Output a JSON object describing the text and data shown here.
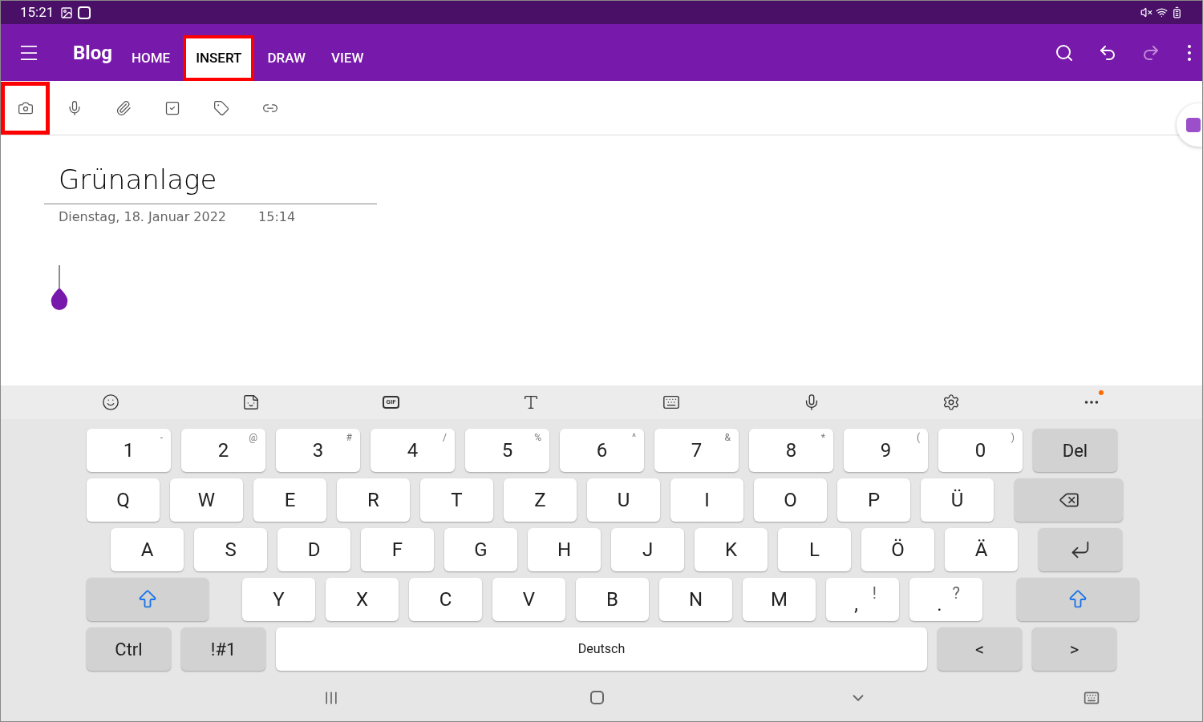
{
  "status_bar": {
    "time": "15:21"
  },
  "app_bar": {
    "notebook": "Blog",
    "tabs": [
      {
        "label": "HOME",
        "selected": false,
        "highlighted": false
      },
      {
        "label": "INSERT",
        "selected": true,
        "highlighted": true
      },
      {
        "label": "DRAW",
        "selected": false,
        "highlighted": false
      },
      {
        "label": "VIEW",
        "selected": false,
        "highlighted": false
      }
    ],
    "redo_disabled": true
  },
  "ribbon": {
    "tools": [
      {
        "kind": "camera",
        "highlighted": true
      },
      {
        "kind": "microphone",
        "highlighted": false
      },
      {
        "kind": "attachment",
        "highlighted": false
      },
      {
        "kind": "checkbox",
        "highlighted": false
      },
      {
        "kind": "tag",
        "highlighted": false
      },
      {
        "kind": "link",
        "highlighted": false
      }
    ]
  },
  "page": {
    "title": "Grünanlage",
    "date": "Dienstag, 18. Januar 2022",
    "time": "15:14"
  },
  "keyboard": {
    "more_notification": true,
    "gif_label": "GIF",
    "rows": [
      {
        "keys": [
          {
            "kind": "char",
            "label": "1",
            "hint": "-"
          },
          {
            "kind": "char",
            "label": "2",
            "hint": "@"
          },
          {
            "kind": "char",
            "label": "3",
            "hint": "#"
          },
          {
            "kind": "char",
            "label": "4",
            "hint": "/"
          },
          {
            "kind": "char",
            "label": "5",
            "hint": "%"
          },
          {
            "kind": "char",
            "label": "6",
            "hint": "^"
          },
          {
            "kind": "char",
            "label": "7",
            "hint": "&"
          },
          {
            "kind": "char",
            "label": "8",
            "hint": "*"
          },
          {
            "kind": "char",
            "label": "9",
            "hint": "("
          },
          {
            "kind": "char",
            "label": "0",
            "hint": ")"
          },
          {
            "kind": "fn",
            "label": "Del"
          }
        ]
      },
      {
        "keys": [
          {
            "kind": "char",
            "label": "Q"
          },
          {
            "kind": "char",
            "label": "W"
          },
          {
            "kind": "char",
            "label": "E"
          },
          {
            "kind": "char",
            "label": "R"
          },
          {
            "kind": "char",
            "label": "T"
          },
          {
            "kind": "char",
            "label": "Z"
          },
          {
            "kind": "char",
            "label": "U"
          },
          {
            "kind": "char",
            "label": "I"
          },
          {
            "kind": "char",
            "label": "O"
          },
          {
            "kind": "char",
            "label": "P"
          },
          {
            "kind": "char",
            "label": "Ü"
          },
          {
            "kind": "backspace"
          }
        ]
      },
      {
        "keys": [
          {
            "kind": "char",
            "label": "A"
          },
          {
            "kind": "char",
            "label": "S"
          },
          {
            "kind": "char",
            "label": "D"
          },
          {
            "kind": "char",
            "label": "F"
          },
          {
            "kind": "char",
            "label": "G"
          },
          {
            "kind": "char",
            "label": "H"
          },
          {
            "kind": "char",
            "label": "J"
          },
          {
            "kind": "char",
            "label": "K"
          },
          {
            "kind": "char",
            "label": "L"
          },
          {
            "kind": "char",
            "label": "Ö"
          },
          {
            "kind": "char",
            "label": "Ä"
          },
          {
            "kind": "enter"
          }
        ]
      },
      {
        "keys": [
          {
            "kind": "shift"
          },
          {
            "kind": "char",
            "label": "Y"
          },
          {
            "kind": "char",
            "label": "X"
          },
          {
            "kind": "char",
            "label": "C"
          },
          {
            "kind": "char",
            "label": "V"
          },
          {
            "kind": "char",
            "label": "B"
          },
          {
            "kind": "char",
            "label": "N"
          },
          {
            "kind": "char",
            "label": "M"
          },
          {
            "kind": "punct",
            "label": ",",
            "hint": "!"
          },
          {
            "kind": "punct",
            "label": ".",
            "hint": "?"
          },
          {
            "kind": "shift"
          }
        ]
      },
      {
        "keys": [
          {
            "kind": "fn",
            "label": "Ctrl"
          },
          {
            "kind": "fn",
            "label": "!#1"
          },
          {
            "kind": "space",
            "label": "Deutsch"
          },
          {
            "kind": "fn",
            "label": "<"
          },
          {
            "kind": "fn",
            "label": ">"
          }
        ]
      }
    ]
  }
}
